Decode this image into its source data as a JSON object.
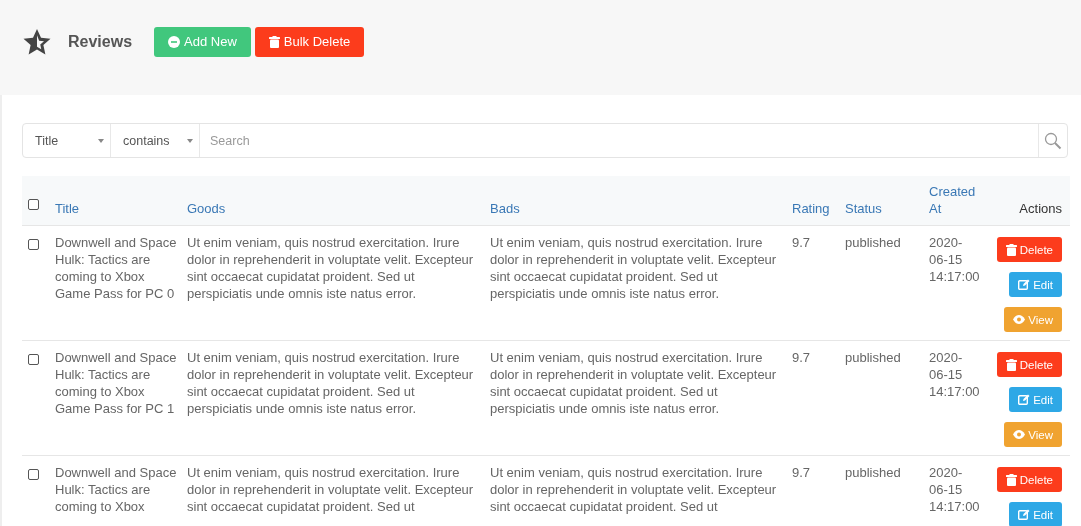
{
  "page": {
    "title": "Reviews"
  },
  "buttons": [
    {
      "label": "Add New",
      "kind": "add"
    },
    {
      "label": "Bulk Delete",
      "kind": "bulk-delete"
    }
  ],
  "filter": {
    "field": "Title",
    "operator": "contains",
    "placeholder": "Search"
  },
  "table": {
    "select_all_checked": false,
    "columns": [
      {
        "label": "Title",
        "kind": "sortable"
      },
      {
        "label": "Goods",
        "kind": "sortable"
      },
      {
        "label": "Bads",
        "kind": "sortable"
      },
      {
        "label": "Rating",
        "kind": "sortable"
      },
      {
        "label": "Status",
        "kind": "sortable"
      },
      {
        "label": "Created At",
        "kind": "sortable"
      },
      {
        "label": "Actions",
        "kind": "plain"
      }
    ],
    "rows": [
      {
        "checked": false,
        "title": "Downwell and Space Hulk: Tactics are coming to Xbox Game Pass for PC 0",
        "goods": "Ut enim veniam, quis nostrud exercitation. Irure dolor in reprehenderit in voluptate velit. Excepteur sint occaecat cupidatat proident. Sed ut perspiciatis unde omnis iste natus error.",
        "bads": "Ut enim veniam, quis nostrud exercitation. Irure dolor in reprehenderit in voluptate velit. Excepteur sint occaecat cupidatat proident. Sed ut perspiciatis unde omnis iste natus error.",
        "rating": "9.7",
        "status": "published",
        "created_at": "2020-06-15 14:17:00",
        "actions": [
          {
            "label": "Delete",
            "kind": "delete"
          },
          {
            "label": "Edit",
            "kind": "edit"
          },
          {
            "label": "View",
            "kind": "view"
          }
        ]
      },
      {
        "checked": false,
        "title": "Downwell and Space Hulk: Tactics are coming to Xbox Game Pass for PC 1",
        "goods": "Ut enim veniam, quis nostrud exercitation. Irure dolor in reprehenderit in voluptate velit. Excepteur sint occaecat cupidatat proident. Sed ut perspiciatis unde omnis iste natus error.",
        "bads": "Ut enim veniam, quis nostrud exercitation. Irure dolor in reprehenderit in voluptate velit. Excepteur sint occaecat cupidatat proident. Sed ut perspiciatis unde omnis iste natus error.",
        "rating": "9.7",
        "status": "published",
        "created_at": "2020-06-15 14:17:00",
        "actions": [
          {
            "label": "Delete",
            "kind": "delete"
          },
          {
            "label": "Edit",
            "kind": "edit"
          },
          {
            "label": "View",
            "kind": "view"
          }
        ]
      },
      {
        "checked": false,
        "title": "Downwell and Space Hulk: Tactics are coming to Xbox",
        "goods": "Ut enim veniam, quis nostrud exercitation. Irure dolor in reprehenderit in voluptate velit. Excepteur sint occaecat cupidatat proident. Sed ut",
        "bads": "Ut enim veniam, quis nostrud exercitation. Irure dolor in reprehenderit in voluptate velit. Excepteur sint occaecat cupidatat proident. Sed ut",
        "rating": "9.7",
        "status": "published",
        "created_at": "2020-06-15 14:17:00",
        "actions": [
          {
            "label": "Delete",
            "kind": "delete"
          },
          {
            "label": "Edit",
            "kind": "edit"
          }
        ]
      }
    ]
  }
}
